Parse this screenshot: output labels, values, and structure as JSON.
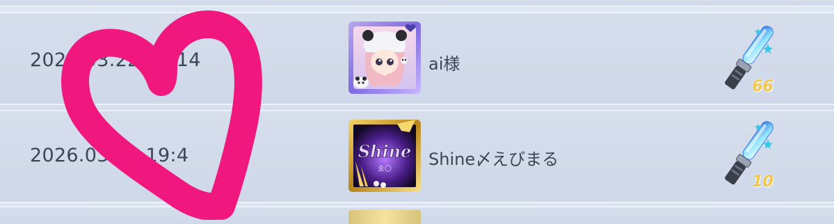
{
  "rows": [
    {
      "time": "2026.03.22 20:14",
      "name": "ai様",
      "avatar": "panda-hat-girl-avatar",
      "gift_icon": "penlight-icon",
      "gift_count": "66"
    },
    {
      "time": "2026.03.22 19:4",
      "name": "Shine〆えびまる",
      "avatar": "shine-logo-avatar",
      "gift_icon": "penlight-icon",
      "gift_count": "10"
    }
  ],
  "overlay": {
    "shape": "heart-doodle",
    "color": "#f0187e"
  },
  "colors": {
    "text": "#3a4556",
    "count": "#f4c64a",
    "row_bg": "#d3dbeb"
  }
}
